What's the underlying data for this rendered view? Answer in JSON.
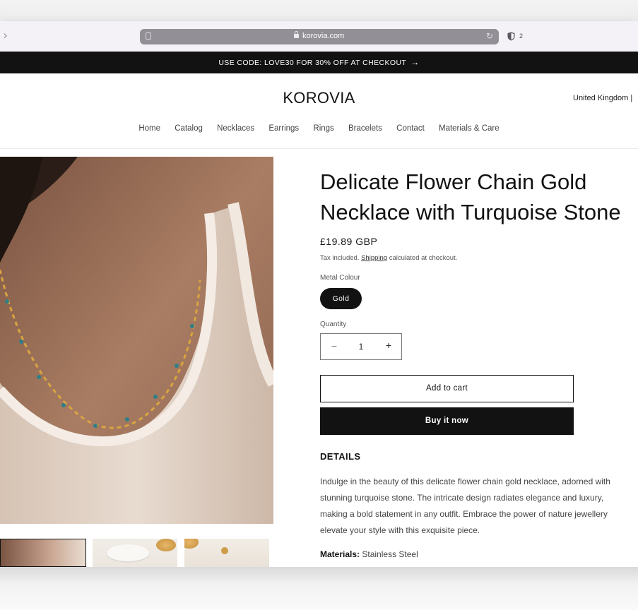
{
  "browser": {
    "url": "korovia.com",
    "shield_count": "2"
  },
  "announcement": {
    "text": "USE CODE: LOVE30 FOR 30% OFF AT CHECKOUT",
    "arrow": "→"
  },
  "header": {
    "logo": "KOROVIA",
    "country": "United Kingdom |",
    "nav": [
      "Home",
      "Catalog",
      "Necklaces",
      "Earrings",
      "Rings",
      "Bracelets",
      "Contact",
      "Materials & Care"
    ]
  },
  "product": {
    "title_line1": "Delicate Flower Chain Gold",
    "title_line2": "Necklace with Turquoise Stone",
    "price": "£19.89 GBP",
    "tax_prefix": "Tax included.",
    "tax_link": "Shipping",
    "tax_suffix": "calculated at checkout.",
    "metal_label": "Metal Colour",
    "metal_selected": "Gold",
    "quantity_label": "Quantity",
    "quantity_value": "1",
    "quantity_minus": "−",
    "quantity_plus": "+",
    "add_to_cart": "Add to cart",
    "buy_now": "Buy it now",
    "details_heading": "DETAILS",
    "details_lines": [
      "Indulge in the beauty of this delicate flower chain gold necklace, adorned with",
      "stunning turquoise stone. The intricate design radiates elegance and luxury,",
      "making a bold statement in any outfit. Embrace the power of nature jewellery",
      "elevate your style with this exquisite piece."
    ],
    "materials_label": "Materials:",
    "materials_value": "Stainless Steel"
  },
  "colors": {
    "announcement_bg": "#121212",
    "primary": "#121212",
    "accent_turquoise": "#2f7f86",
    "gold": "#d9a441"
  },
  "icons": [
    "chevron-right-icon",
    "document-icon",
    "lock-icon",
    "reload-icon",
    "shield-icon",
    "arrow-right-icon"
  ]
}
